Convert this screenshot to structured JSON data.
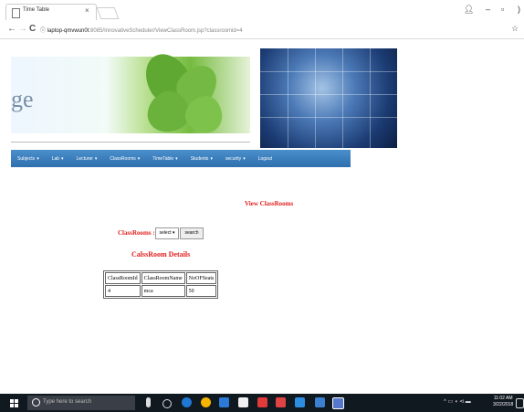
{
  "browser": {
    "tab_title": "Time Table",
    "tab_close": "×",
    "url_host": "laptop-qmvwun0t",
    "url_rest": ":8085/InnovativeScheduler/ViewClassRoom.jsp?classroomid=4",
    "info_icon": "ⓘ",
    "back": "←",
    "forward": "→",
    "reload": "C",
    "bookmark_icon": "☆",
    "profile_icon": "person-icon"
  },
  "banner": {
    "text": "ge"
  },
  "menu": [
    {
      "label": "Subjects"
    },
    {
      "label": "Lab"
    },
    {
      "label": "Lecturer"
    },
    {
      "label": "ClassRooms"
    },
    {
      "label": "TimeTable"
    },
    {
      "label": "Students"
    },
    {
      "label": "security"
    },
    {
      "label": "Logout"
    }
  ],
  "menu_caret": "▾",
  "content": {
    "page_heading": "View ClassRooms",
    "classrooms_label": "ClassRooms :",
    "select_value": "select ▾",
    "search_button": "search",
    "details_heading": "CalssRoom Details",
    "table": {
      "headers": [
        "ClassRoomId",
        "ClassRoomName",
        "NoOFSeats"
      ],
      "rows": [
        [
          "4",
          "mca",
          "50"
        ]
      ]
    }
  },
  "taskbar": {
    "search_placeholder": "Type here to search",
    "time": "11:02 AM",
    "date": "3/22/2018"
  },
  "colors": {
    "accent_red": "#e02020",
    "menu_blue": "#3a80c0",
    "taskbar": "#101820"
  }
}
